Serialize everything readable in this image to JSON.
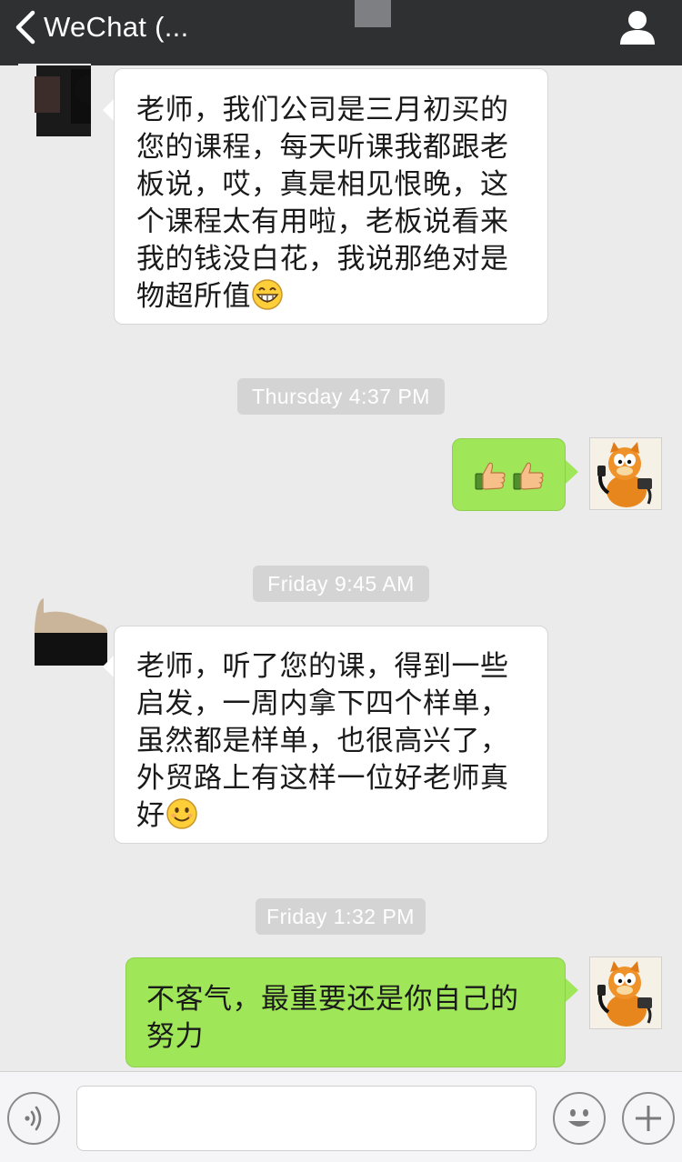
{
  "nav": {
    "back_label": "WeChat (..."
  },
  "messages": [
    {
      "side": "incoming",
      "lines": [
        "老师，我们公司是三月初买的",
        "您的课程，每天听课我都跟老",
        "板说，哎，真是相见恨晚，这",
        "个课程太有用啦，老板说看来",
        "我的钱没白花，我说那绝对是",
        "物超所值"
      ],
      "trailing_emoji": "grinning-face-emoji"
    },
    {
      "side": "outgoing",
      "emojis": [
        "thumbs-up-emoji",
        "thumbs-up-emoji"
      ]
    },
    {
      "side": "incoming",
      "lines": [
        "老师，听了您的课，得到一些",
        "启发，一周内拿下四个样单，",
        "虽然都是样单，也很高兴了，",
        "外贸路上有这样一位好老师真",
        "好"
      ],
      "trailing_emoji": "smiling-face-emoji"
    },
    {
      "side": "outgoing",
      "lines": [
        "不客气，最重要还是你自己的",
        "努力"
      ]
    }
  ],
  "timestamps": [
    "Thursday 4:37 PM",
    "Friday 9:45 AM",
    "Friday 1:32 PM"
  ],
  "input": {
    "value": "",
    "placeholder": ""
  },
  "colors": {
    "navbar": "#2e3032",
    "background": "#ebebeb",
    "outgoing_bubble": "#9fe658",
    "incoming_bubble": "#ffffff",
    "timestamp_pill": "#d4d4d4"
  }
}
